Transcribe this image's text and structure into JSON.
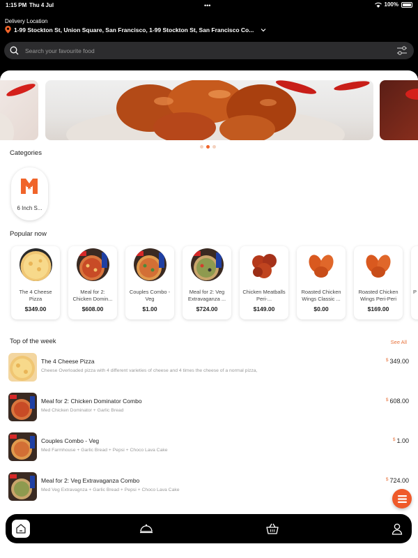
{
  "status_bar": {
    "time": "1:15 PM",
    "date": "Thu 4 Jul",
    "battery": "100%"
  },
  "header": {
    "location_label": "Delivery Location",
    "location_address": "1-99 Stockton St,  Union Square, San Francisco, 1-99 Stockton St, San Francisco Co...",
    "search_placeholder": "Search your favourite food"
  },
  "carousel": {
    "slides": 3,
    "active_index": 1
  },
  "categories": {
    "title": "Categories",
    "items": [
      {
        "label": "6 Inch S...",
        "icon": "brand-logo-icon"
      }
    ]
  },
  "popular": {
    "title": "Popular now",
    "items": [
      {
        "name": "The 4 Cheese Pizza",
        "price": "$349.00",
        "image": "pizza-cheese"
      },
      {
        "name": "Meal for 2: Chicken Domin...",
        "price": "$608.00",
        "image": "pizza-meal"
      },
      {
        "name": "Couples Combo - Veg",
        "price": "$1.00",
        "image": "pizza-meal"
      },
      {
        "name": "Meal for 2: Veg Extravaganza ...",
        "price": "$724.00",
        "image": "pizza-meal"
      },
      {
        "name": "Chicken Meatballs Peri-...",
        "price": "$149.00",
        "image": "meatballs"
      },
      {
        "name": "Roasted Chicken Wings Classic ...",
        "price": "$0.00",
        "image": "wings"
      },
      {
        "name": "Roasted Chicken Wings Peri-Peri",
        "price": "$169.00",
        "image": "wings"
      },
      {
        "name": "P",
        "price": "",
        "image": "partial"
      }
    ]
  },
  "top_week": {
    "title": "Top of the week",
    "see_all": "See All",
    "items": [
      {
        "name": "The 4 Cheese Pizza",
        "desc": "Cheese Overloaded pizza with 4 different varieties of cheese and 4 times the cheese of a normal pizza,",
        "currency": "$",
        "price": "349.00"
      },
      {
        "name": "Meal for 2: Chicken Dominator Combo",
        "desc": "Med Chicken Dominator + Garlic Bread",
        "currency": "$",
        "price": "608.00"
      },
      {
        "name": "Couples Combo - Veg",
        "desc": "Med Farmhouse + Garlic Bread + Pepsi + Choco Lava Cake",
        "currency": "$",
        "price": "1.00"
      },
      {
        "name": "Meal for 2: Veg Extravaganza Combo",
        "desc": "Med Veg Extravagnza + Garlic Bread + Pepsi + Choco Lava Cake",
        "currency": "$",
        "price": "724.00"
      }
    ]
  },
  "tabbar": {
    "tabs": [
      "home-icon",
      "cloche-icon",
      "basket-icon",
      "profile-icon"
    ],
    "active": "home-icon"
  },
  "colors": {
    "accent": "#F0642A",
    "background": "#000000",
    "card": "#FFFFFF"
  }
}
